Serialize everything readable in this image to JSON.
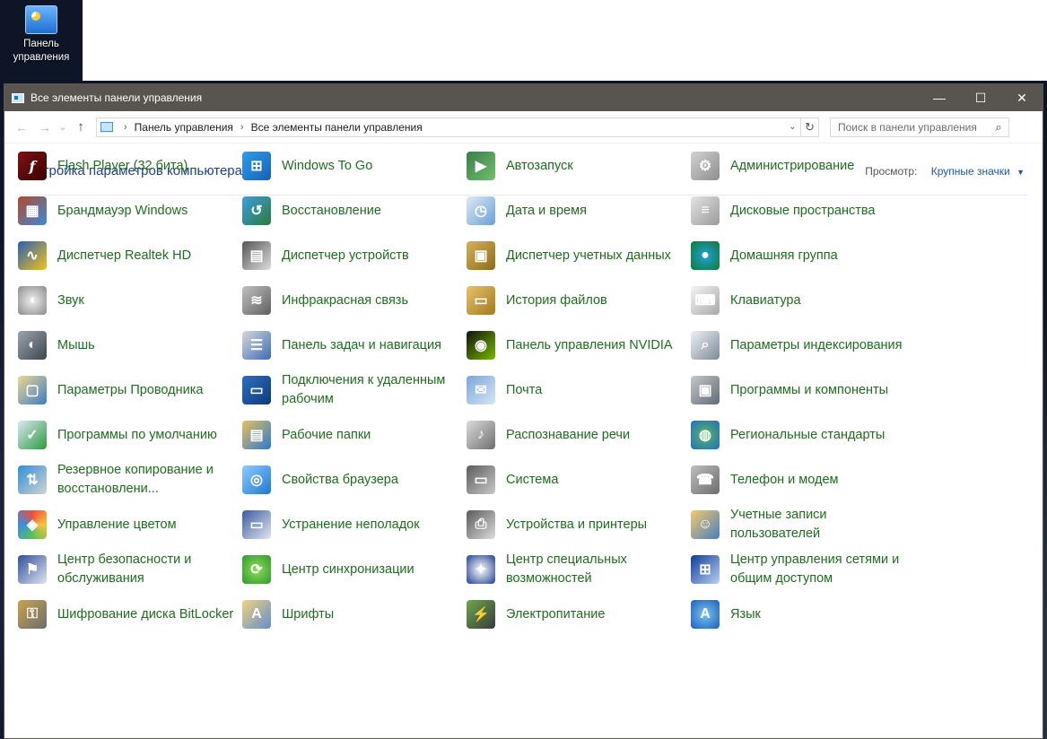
{
  "desktop": {
    "icon_label": "Панель\nуправления",
    "icon_label_line1": "Панель",
    "icon_label_line2": "управления"
  },
  "window": {
    "title": "Все элементы панели управления",
    "controls": {
      "minimize": "—",
      "maximize": "☐",
      "close": "✕"
    }
  },
  "nav": {
    "back": "←",
    "forward": "→",
    "recent": "⌄",
    "up": "↑",
    "breadcrumb": [
      "Панель управления",
      "Все элементы панели управления"
    ],
    "breadcrumb_sep": "›",
    "dropdown": "⌄",
    "refresh": "↻",
    "search_placeholder": "Поиск в панели управления",
    "search_icon": "⌕"
  },
  "header": {
    "title": "Настройка параметров компьютера",
    "view_label": "Просмотр:",
    "view_value": "Крупные значки",
    "view_caret": "▼"
  },
  "items": [
    {
      "label": "Flash Player (32 бита)",
      "icon": "flash-player-icon",
      "glyph": "f"
    },
    {
      "label": "Windows To Go",
      "icon": "windows-to-go-icon",
      "glyph": "⊞"
    },
    {
      "label": "Автозапуск",
      "icon": "autoplay-icon",
      "glyph": "▶"
    },
    {
      "label": "Администрирование",
      "icon": "administrative-tools-icon",
      "glyph": "⚙"
    },
    {
      "label": "Брандмауэр Windows",
      "icon": "firewall-icon",
      "glyph": "▦"
    },
    {
      "label": "Восстановление",
      "icon": "recovery-icon",
      "glyph": "↺"
    },
    {
      "label": "Дата и время",
      "icon": "date-time-icon",
      "glyph": "◷"
    },
    {
      "label": "Дисковые пространства",
      "icon": "storage-spaces-icon",
      "glyph": "≡"
    },
    {
      "label": "Диспетчер Realtek HD",
      "icon": "realtek-icon",
      "glyph": "∿"
    },
    {
      "label": "Диспетчер устройств",
      "icon": "device-manager-icon",
      "glyph": "▤"
    },
    {
      "label": "Диспетчер учетных данных",
      "icon": "credential-manager-icon",
      "glyph": "▣"
    },
    {
      "label": "Домашняя группа",
      "icon": "homegroup-icon",
      "glyph": "●"
    },
    {
      "label": "Звук",
      "icon": "sound-icon",
      "glyph": "◖"
    },
    {
      "label": "Инфракрасная связь",
      "icon": "infrared-icon",
      "glyph": "≋"
    },
    {
      "label": "История файлов",
      "icon": "file-history-icon",
      "glyph": "▭"
    },
    {
      "label": "Клавиатура",
      "icon": "keyboard-icon",
      "glyph": "⌨"
    },
    {
      "label": "Мышь",
      "icon": "mouse-icon",
      "glyph": "◐"
    },
    {
      "label": "Панель задач и навигация",
      "icon": "taskbar-icon",
      "glyph": "☰"
    },
    {
      "label": "Панель управления NVIDIA",
      "icon": "nvidia-icon",
      "glyph": "◉"
    },
    {
      "label": "Параметры индексирования",
      "icon": "indexing-options-icon",
      "glyph": "⌕"
    },
    {
      "label": "Параметры Проводника",
      "icon": "explorer-options-icon",
      "glyph": "▢"
    },
    {
      "label": "Подключения к удаленным рабочим",
      "icon": "remote-desktop-icon",
      "glyph": "▭"
    },
    {
      "label": "Почта",
      "icon": "mail-icon",
      "glyph": "✉"
    },
    {
      "label": "Программы и компоненты",
      "icon": "programs-features-icon",
      "glyph": "▣"
    },
    {
      "label": "Программы по умолчанию",
      "icon": "default-programs-icon",
      "glyph": "✓"
    },
    {
      "label": "Рабочие папки",
      "icon": "work-folders-icon",
      "glyph": "▤"
    },
    {
      "label": "Распознавание речи",
      "icon": "speech-recognition-icon",
      "glyph": "♪"
    },
    {
      "label": "Региональные стандарты",
      "icon": "region-icon",
      "glyph": "◍"
    },
    {
      "label": "Резервное копирование и восстановлени...",
      "icon": "backup-restore-icon",
      "glyph": "⇅"
    },
    {
      "label": "Свойства браузера",
      "icon": "internet-options-icon",
      "glyph": "◎"
    },
    {
      "label": "Система",
      "icon": "system-icon",
      "glyph": "▭"
    },
    {
      "label": "Телефон и модем",
      "icon": "phone-modem-icon",
      "glyph": "☎"
    },
    {
      "label": "Управление цветом",
      "icon": "color-management-icon",
      "glyph": "◈"
    },
    {
      "label": "Устранение неполадок",
      "icon": "troubleshooting-icon",
      "glyph": "▭"
    },
    {
      "label": "Устройства и принтеры",
      "icon": "devices-printers-icon",
      "glyph": "⎙"
    },
    {
      "label": "Учетные записи пользователей",
      "icon": "user-accounts-icon",
      "glyph": "☺"
    },
    {
      "label": "Центр безопасности и обслуживания",
      "icon": "security-center-icon",
      "glyph": "⚑"
    },
    {
      "label": "Центр синхронизации",
      "icon": "sync-center-icon",
      "glyph": "⟳"
    },
    {
      "label": "Центр специальных возможностей",
      "icon": "ease-of-access-icon",
      "glyph": "✦"
    },
    {
      "label": "Центр управления сетями и общим доступом",
      "icon": "network-sharing-icon",
      "glyph": "⊞"
    },
    {
      "label": "Шифрование диска BitLocker",
      "icon": "bitlocker-icon",
      "glyph": "⚿"
    },
    {
      "label": "Шрифты",
      "icon": "fonts-icon",
      "glyph": "A"
    },
    {
      "label": "Электропитание",
      "icon": "power-options-icon",
      "glyph": "⚡"
    },
    {
      "label": "Язык",
      "icon": "language-icon",
      "glyph": "A"
    }
  ]
}
